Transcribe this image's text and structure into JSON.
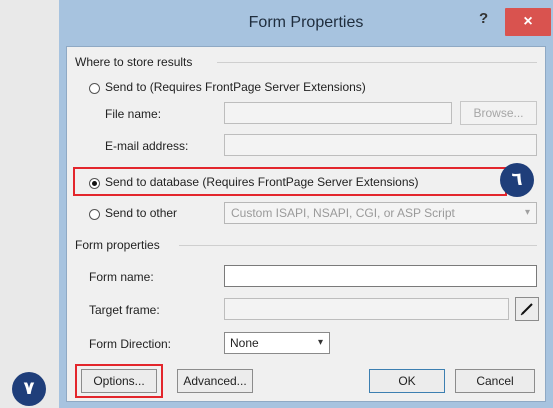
{
  "dialog": {
    "title": "Form Properties",
    "help_label": "?",
    "close_label": "×"
  },
  "store_group": {
    "label": "Where to store results",
    "send_to": "Send to (Requires FrontPage Server Extensions)",
    "file_name_label": "File name:",
    "browse_label": "Browse...",
    "email_label": "E-mail address:",
    "send_db": "Send to database (Requires FrontPage Server Extensions)",
    "send_other": "Send to other",
    "other_combo_value": "Custom ISAPI, NSAPI, CGI, or ASP Script"
  },
  "form_group": {
    "label": "Form properties",
    "name_label": "Form name:",
    "target_label": "Target frame:",
    "direction_label": "Form Direction:",
    "direction_value": "None"
  },
  "buttons": {
    "options": "Options...",
    "advanced": "Advanced...",
    "ok": "OK",
    "cancel": "Cancel"
  },
  "callouts": {
    "six": "٦",
    "seven": "٧"
  },
  "icons": {
    "target_pick": "pencil-icon",
    "combo_arrow": "chevron-down-icon"
  },
  "colors": {
    "highlight": "#e3262c",
    "badge": "#1f3e7a",
    "close_button": "#d9534f"
  }
}
